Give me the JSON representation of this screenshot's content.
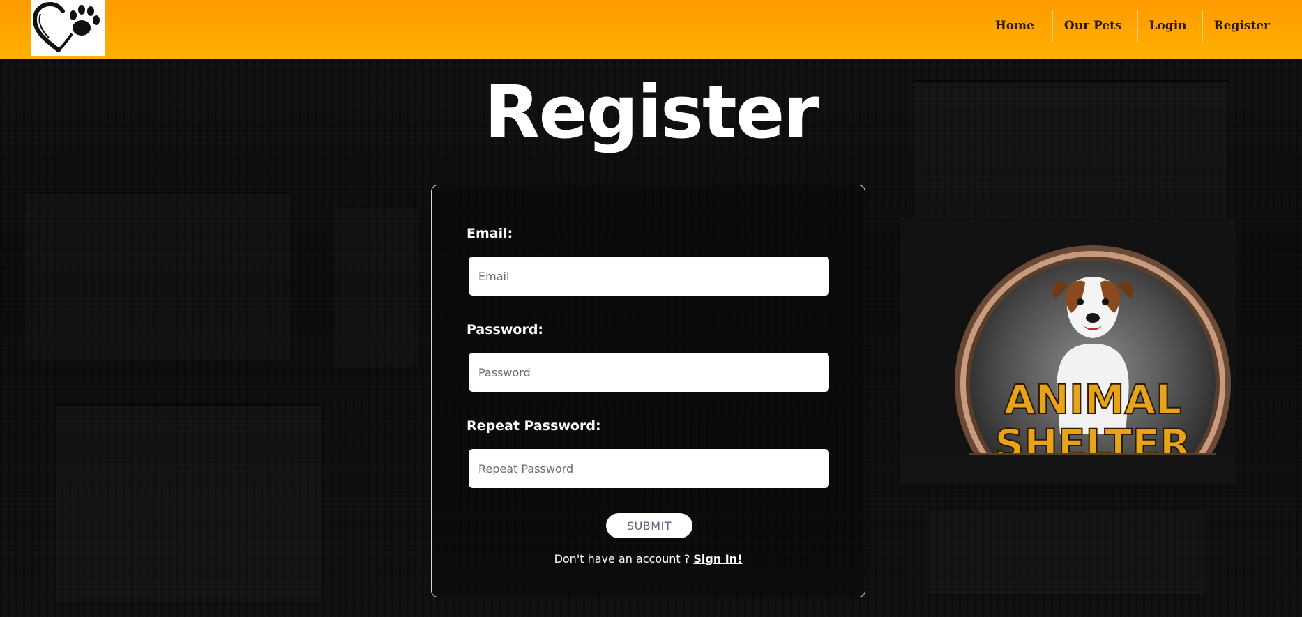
{
  "header": {
    "nav": [
      {
        "label": "Home"
      },
      {
        "label": "Our Pets"
      },
      {
        "label": "Login"
      },
      {
        "label": "Register"
      }
    ],
    "brand_color": "#ffa500"
  },
  "page": {
    "title": "Register"
  },
  "form": {
    "email": {
      "label": "Email:",
      "placeholder": "Email",
      "value": ""
    },
    "password": {
      "label": "Password:",
      "placeholder": "Password",
      "value": ""
    },
    "repeat_password": {
      "label": "Repeat Password:",
      "placeholder": "Repeat Password",
      "value": ""
    },
    "submit_label": "SUBMIT",
    "account_prompt": "Don't have an account ? ",
    "signin_link": "Sign In!"
  },
  "shelter_image": {
    "line1": "ANIMAL",
    "line2": "SHELTER"
  }
}
